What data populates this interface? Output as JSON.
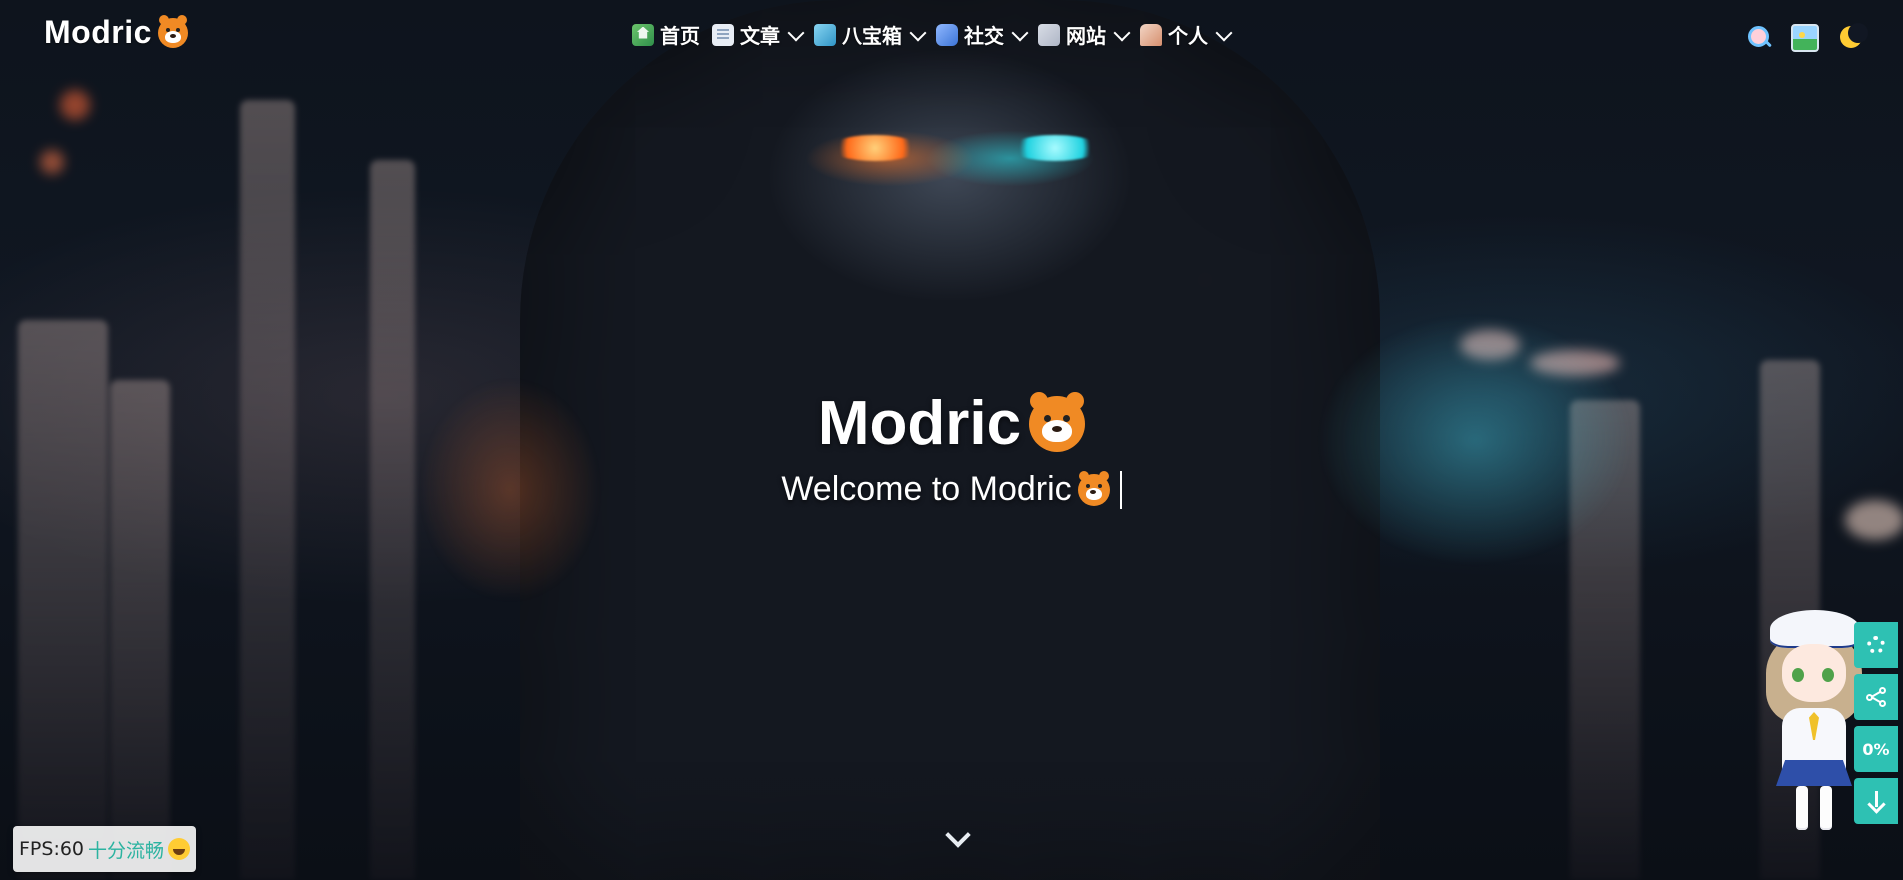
{
  "site": {
    "logo_text": "Modric"
  },
  "nav": {
    "items": [
      {
        "label": "首页",
        "icon": "home-icon",
        "has_dropdown": false
      },
      {
        "label": "文章",
        "icon": "document-icon",
        "has_dropdown": true
      },
      {
        "label": "八宝箱",
        "icon": "box-icon",
        "has_dropdown": true
      },
      {
        "label": "社交",
        "icon": "chat-icon",
        "has_dropdown": true
      },
      {
        "label": "网站",
        "icon": "website-icon",
        "has_dropdown": true
      },
      {
        "label": "个人",
        "icon": "person-icon",
        "has_dropdown": true
      }
    ],
    "actions": [
      "search-icon",
      "image-icon",
      "moon-icon"
    ]
  },
  "hero": {
    "title": "Modric",
    "subtitle": "Welcome to Modric"
  },
  "fps": {
    "label": "FPS:60",
    "status": "十分流畅"
  },
  "side_buttons": {
    "progress": "0%"
  },
  "colors": {
    "accent_teal": "#2ec1b3",
    "tiger_orange": "#f08a24",
    "text_white": "#ffffff"
  }
}
